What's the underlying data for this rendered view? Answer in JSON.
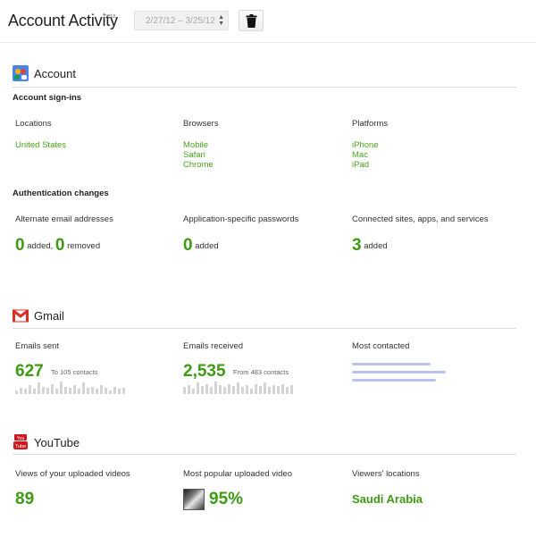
{
  "header": {
    "title": "Account Activity",
    "beta": "beta",
    "date_range": "2/27/12 – 3/25/12"
  },
  "account": {
    "title": "Account",
    "signins_heading": "Account sign-ins",
    "locations_label": "Locations",
    "locations": [
      "United States"
    ],
    "browsers_label": "Browsers",
    "browsers": [
      "Mobile",
      "Safari",
      "Chrome"
    ],
    "platforms_label": "Platforms",
    "platforms": [
      "iPhone",
      "Mac",
      "iPad"
    ],
    "auth_heading": "Authentication changes",
    "alt_email_label": "Alternate email addresses",
    "alt_added": "0",
    "alt_added_text": " added, ",
    "alt_removed": "0",
    "alt_removed_text": " removed",
    "app_pw_label": "Application-specific passwords",
    "app_pw_added": "0",
    "app_pw_text": " added",
    "connected_label": "Connected sites, apps, and services",
    "connected_added": "3",
    "connected_text": " added"
  },
  "gmail": {
    "title": "Gmail",
    "sent_label": "Emails sent",
    "sent_value": "627",
    "sent_note": "To 105 contacts",
    "sent_spark": [
      3,
      5,
      4,
      7,
      4,
      9,
      6,
      5,
      8,
      4,
      10,
      6,
      5,
      7,
      4,
      9,
      5,
      6,
      4,
      7,
      5,
      3,
      6,
      4,
      5
    ],
    "received_label": "Emails received",
    "received_value": "2,535",
    "received_note": "From 483 contacts",
    "received_spark": [
      6,
      8,
      5,
      10,
      7,
      9,
      6,
      11,
      8,
      6,
      9,
      7,
      10,
      6,
      8,
      5,
      9,
      7,
      10,
      6,
      8,
      7,
      9,
      6,
      8
    ],
    "contacted_label": "Most contacted"
  },
  "youtube": {
    "title": "YouTube",
    "views_label": "Views of your uploaded videos",
    "views_value": "89",
    "popular_label": "Most popular uploaded video",
    "popular_value": "95%",
    "locations_label": "Viewers' locations",
    "locations_value": "Saudi Arabia"
  },
  "colors": {
    "accent_green": "#3f9a14",
    "link_green": "#49a31b",
    "gmail_red": "#d93025",
    "youtube_red": "#cc181e"
  },
  "icons": [
    "trash-icon",
    "google-account-icon",
    "gmail-icon",
    "youtube-icon",
    "sort-arrows-icon"
  ]
}
